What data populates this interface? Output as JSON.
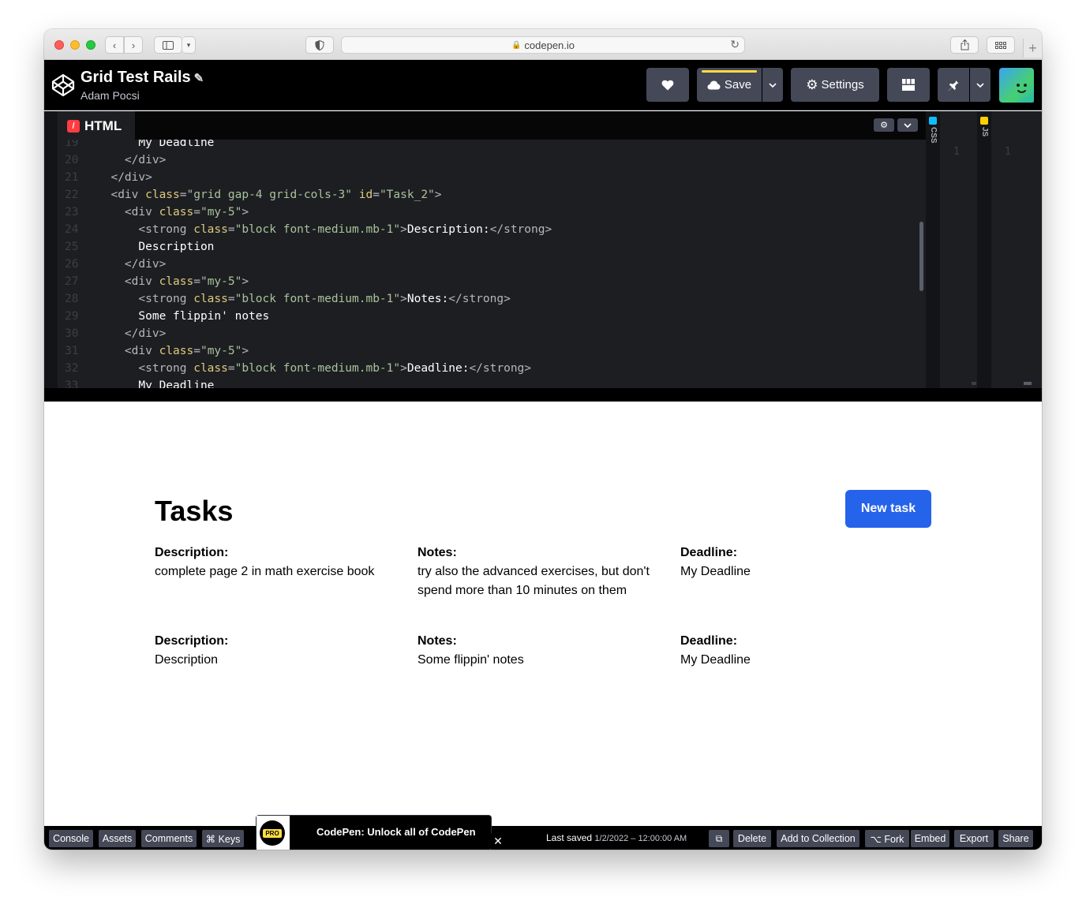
{
  "browser": {
    "url": "codepen.io"
  },
  "header": {
    "title": "Grid Test Rails",
    "author": "Adam Pocsi",
    "save_label": "Save",
    "settings_label": "Settings"
  },
  "editor": {
    "tab_label": "HTML",
    "css_label": "CSS",
    "js_label": "JS",
    "css_line": "1",
    "js_line": "1",
    "lines": [
      {
        "n": "19",
        "code": [
          {
            "t": "text",
            "v": "      My Deadline"
          }
        ]
      },
      {
        "n": "20",
        "code": [
          {
            "t": "tag",
            "v": "    </div>"
          }
        ]
      },
      {
        "n": "21",
        "code": [
          {
            "t": "tag",
            "v": "  </div>"
          }
        ]
      },
      {
        "n": "22",
        "code": [
          {
            "t": "tag",
            "v": "  <div "
          },
          {
            "t": "attr",
            "v": "class"
          },
          {
            "t": "tag",
            "v": "="
          },
          {
            "t": "val",
            "v": "\"grid gap-4 grid-cols-3\""
          },
          {
            "t": "tag",
            "v": " "
          },
          {
            "t": "attr",
            "v": "id"
          },
          {
            "t": "tag",
            "v": "="
          },
          {
            "t": "val",
            "v": "\"Task_2\""
          },
          {
            "t": "tag",
            "v": ">"
          }
        ]
      },
      {
        "n": "23",
        "code": [
          {
            "t": "tag",
            "v": "    <div "
          },
          {
            "t": "attr",
            "v": "class"
          },
          {
            "t": "tag",
            "v": "="
          },
          {
            "t": "val",
            "v": "\"my-5\""
          },
          {
            "t": "tag",
            "v": ">"
          }
        ]
      },
      {
        "n": "24",
        "code": [
          {
            "t": "tag",
            "v": "      <strong "
          },
          {
            "t": "attr",
            "v": "class"
          },
          {
            "t": "tag",
            "v": "="
          },
          {
            "t": "val",
            "v": "\"block font-medium.mb-1\""
          },
          {
            "t": "tag",
            "v": ">"
          },
          {
            "t": "text",
            "v": "Description:"
          },
          {
            "t": "tag",
            "v": "</strong>"
          }
        ]
      },
      {
        "n": "25",
        "code": [
          {
            "t": "text",
            "v": "      Description"
          }
        ]
      },
      {
        "n": "26",
        "code": [
          {
            "t": "tag",
            "v": "    </div>"
          }
        ]
      },
      {
        "n": "27",
        "code": [
          {
            "t": "tag",
            "v": "    <div "
          },
          {
            "t": "attr",
            "v": "class"
          },
          {
            "t": "tag",
            "v": "="
          },
          {
            "t": "val",
            "v": "\"my-5\""
          },
          {
            "t": "tag",
            "v": ">"
          }
        ]
      },
      {
        "n": "28",
        "code": [
          {
            "t": "tag",
            "v": "      <strong "
          },
          {
            "t": "attr",
            "v": "class"
          },
          {
            "t": "tag",
            "v": "="
          },
          {
            "t": "val",
            "v": "\"block font-medium.mb-1\""
          },
          {
            "t": "tag",
            "v": ">"
          },
          {
            "t": "text",
            "v": "Notes:"
          },
          {
            "t": "tag",
            "v": "</strong>"
          }
        ]
      },
      {
        "n": "29",
        "code": [
          {
            "t": "text",
            "v": "      Some flippin' notes"
          }
        ]
      },
      {
        "n": "30",
        "code": [
          {
            "t": "tag",
            "v": "    </div>"
          }
        ]
      },
      {
        "n": "31",
        "code": [
          {
            "t": "tag",
            "v": "    <div "
          },
          {
            "t": "attr",
            "v": "class"
          },
          {
            "t": "tag",
            "v": "="
          },
          {
            "t": "val",
            "v": "\"my-5\""
          },
          {
            "t": "tag",
            "v": ">"
          }
        ]
      },
      {
        "n": "32",
        "code": [
          {
            "t": "tag",
            "v": "      <strong "
          },
          {
            "t": "attr",
            "v": "class"
          },
          {
            "t": "tag",
            "v": "="
          },
          {
            "t": "val",
            "v": "\"block font-medium.mb-1\""
          },
          {
            "t": "tag",
            "v": ">"
          },
          {
            "t": "text",
            "v": "Deadline:"
          },
          {
            "t": "tag",
            "v": "</strong>"
          }
        ]
      },
      {
        "n": "33",
        "code": [
          {
            "t": "text",
            "v": "      My Deadline"
          }
        ]
      }
    ]
  },
  "preview": {
    "title": "Tasks",
    "new_task_label": "New task",
    "tasks": [
      {
        "description_label": "Description:",
        "description": "complete page 2 in math exercise book",
        "notes_label": "Notes:",
        "notes": "try also the advanced exercises, but don't spend more than 10 minutes on them",
        "deadline_label": "Deadline:",
        "deadline": "My Deadline"
      },
      {
        "description_label": "Description:",
        "description": "Description",
        "notes_label": "Notes:",
        "notes": "Some flippin' notes",
        "deadline_label": "Deadline:",
        "deadline": "My Deadline"
      }
    ]
  },
  "footer": {
    "console": "Console",
    "assets": "Assets",
    "comments": "Comments",
    "keys": "⌘ Keys",
    "promo_badge": "PRO",
    "promo_text": "CodePen: Unlock all of CodePen",
    "last_saved_label": "Last saved",
    "last_saved_value": "1/2/2022 – 12:00:00 AM",
    "delete": "Delete",
    "add_to_collection": "Add to Collection",
    "fork": "⌥ Fork",
    "embed": "Embed",
    "export": "Export",
    "share": "Share"
  },
  "icons": {
    "heart": "heart-icon",
    "cloud": "cloud-icon",
    "gear": "gear-icon",
    "layout": "layout-icon",
    "pin": "pin-icon"
  },
  "colors": {
    "accent_blue": "#2563eb",
    "save_bar": "#ffdd40",
    "header_bg": "#000000",
    "button_bg": "#444857"
  }
}
